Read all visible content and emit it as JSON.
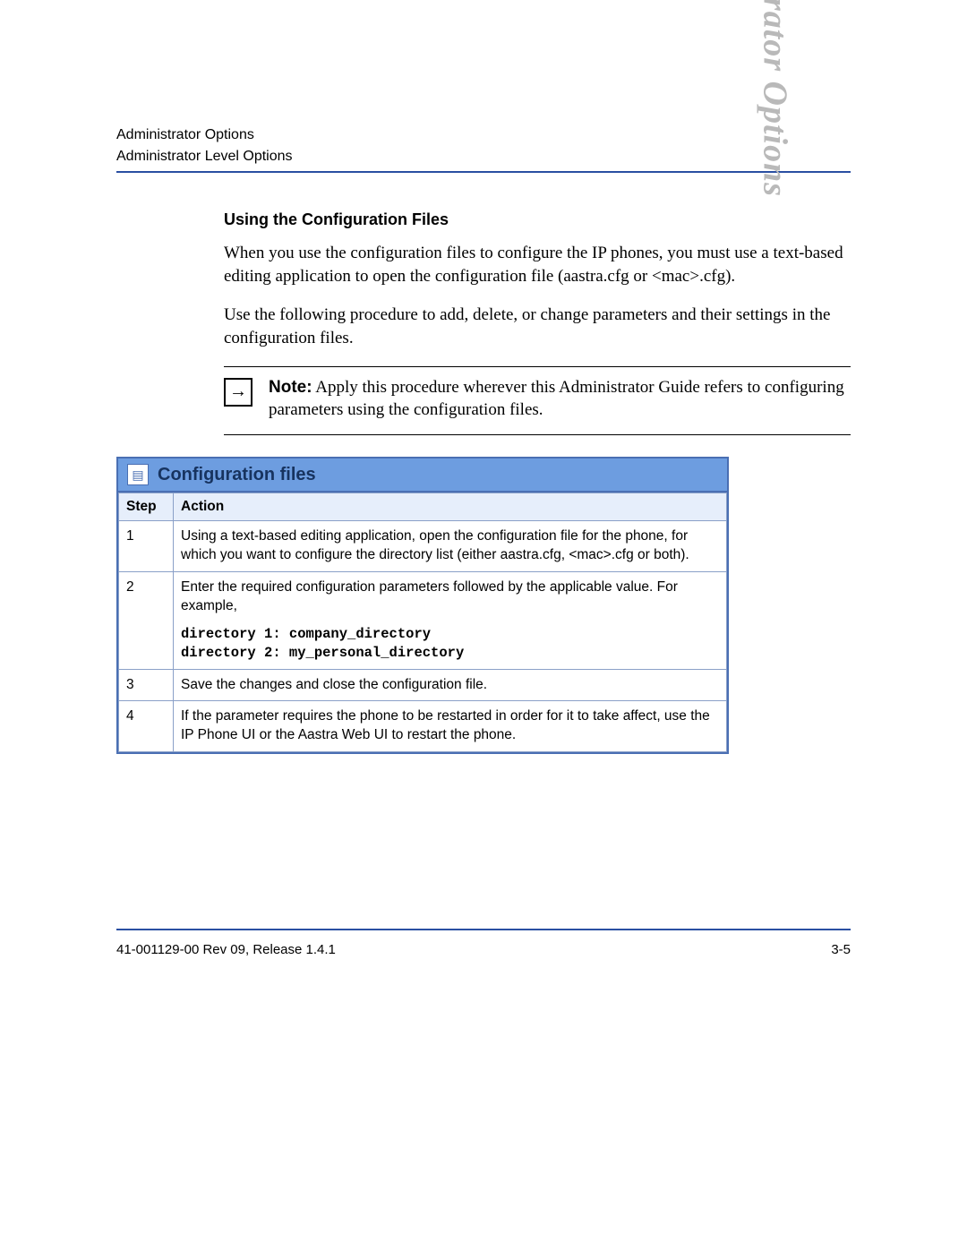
{
  "header": {
    "line1": "Administrator Options",
    "line2": "Administrator Level Options"
  },
  "side_label": "Administrator Options",
  "section": {
    "title": "Using the Configuration Files",
    "para1": "When you use the configuration files to configure the IP phones, you must use a text-based editing application to open the configuration file (aastra.cfg or <mac>.cfg).",
    "para2": "Use the following procedure to add, delete, or change parameters and their settings in the configuration files."
  },
  "note": {
    "label": "Note:",
    "text": " Apply this procedure wherever this Administrator Guide refers to configuring parameters using the configuration files."
  },
  "proc": {
    "title": "Configuration files",
    "headers": {
      "step": "Step",
      "action": "Action"
    },
    "rows": [
      {
        "step": "1",
        "action": "Using a text-based editing application, open the configuration file for the phone, for which you want to configure the directory list (either aastra.cfg, <mac>.cfg or both)."
      },
      {
        "step": "2",
        "action": "Enter the required configuration parameters followed by the applicable value. For example,",
        "code": "directory 1: company_directory\ndirectory 2: my_personal_directory"
      },
      {
        "step": "3",
        "action": "Save the changes and close the configuration file."
      },
      {
        "step": "4",
        "action": "If the parameter requires the phone to be restarted in order for it to take affect, use the IP Phone UI or the Aastra Web UI to restart the phone."
      }
    ]
  },
  "footer": {
    "left": "41-001129-00 Rev 09, Release 1.4.1",
    "right": "3-5"
  }
}
